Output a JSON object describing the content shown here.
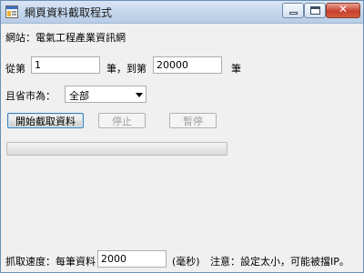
{
  "window": {
    "title": "網頁資料截取程式",
    "close_glyph": "✕"
  },
  "site": {
    "label": "網站：電氣工程產業資訊網"
  },
  "range": {
    "from_label": "從第",
    "from_value": "1",
    "middle_label": "筆，到第",
    "to_value": "20000",
    "end_label": "筆"
  },
  "region": {
    "label": "且省市為：",
    "selected": "全部"
  },
  "buttons": {
    "start": "開始截取資料",
    "stop": "停止",
    "pause": "暫停"
  },
  "progress": {
    "fraction": 0
  },
  "footer": {
    "speed_label": "抓取速度：每筆資料",
    "speed_value": "2000",
    "unit_label": "(毫秒)",
    "note": "注意：設定太小，可能被擋IP。"
  },
  "icons": {
    "app": "app-window-icon",
    "minimize": "minimize-icon",
    "maximize": "maximize-icon",
    "close": "close-icon"
  }
}
